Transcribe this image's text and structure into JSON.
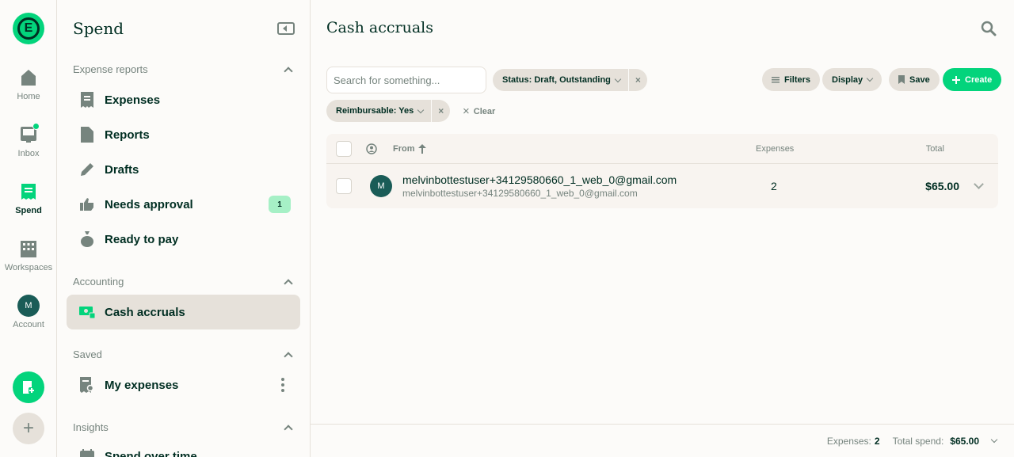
{
  "rail": {
    "items": [
      {
        "label": "Home",
        "icon": "home-icon"
      },
      {
        "label": "Inbox",
        "icon": "inbox-icon"
      },
      {
        "label": "Spend",
        "icon": "receipt-icon"
      },
      {
        "label": "Workspaces",
        "icon": "building-icon"
      },
      {
        "label": "Account",
        "icon": "avatar"
      }
    ],
    "account_initial": "M",
    "logo_letter": "E",
    "add_symbol": "+"
  },
  "sidebar": {
    "title": "Spend",
    "sections": [
      {
        "label": "Expense reports",
        "items": [
          {
            "label": "Expenses",
            "icon": "receipt-icon"
          },
          {
            "label": "Reports",
            "icon": "document-icon"
          },
          {
            "label": "Drafts",
            "icon": "pencil-icon"
          },
          {
            "label": "Needs approval",
            "icon": "thumbs-up-icon",
            "badge": "1"
          },
          {
            "label": "Ready to pay",
            "icon": "money-bag-icon"
          }
        ]
      },
      {
        "label": "Accounting",
        "items": [
          {
            "label": "Cash accruals",
            "icon": "cash-icon",
            "active": true
          }
        ]
      },
      {
        "label": "Saved",
        "items": [
          {
            "label": "My expenses",
            "icon": "receipt-search-icon"
          }
        ]
      },
      {
        "label": "Insights",
        "items": [
          {
            "label": "Spend over time",
            "icon": "calendar-icon"
          }
        ]
      }
    ]
  },
  "main": {
    "title": "Cash accruals",
    "search_placeholder": "Search for something...",
    "filters": {
      "status": "Status: Draft, Outstanding",
      "reimbursable": "Reimbursable: Yes",
      "clear": "Clear",
      "remove_symbol": "×"
    },
    "buttons": {
      "filters": "Filters",
      "display": "Display",
      "save": "Save",
      "create": "Create"
    },
    "table": {
      "columns": {
        "from": "From",
        "expenses": "Expenses",
        "total": "Total"
      },
      "rows": [
        {
          "initial": "M",
          "from_primary": "melvinbottestuser+34129580660_1_web_0@gmail.com",
          "from_secondary": "melvinbottestuser+34129580660_1_web_0@gmail.com",
          "expenses": "2",
          "total": "$65.00"
        }
      ]
    },
    "footer": {
      "expenses_label": "Expenses:",
      "expenses_value": "2",
      "total_label": "Total spend:",
      "total_value": "$65.00"
    }
  },
  "colors": {
    "brand_green": "#03d47c",
    "dark_green": "#002e22",
    "muted": "#76847e",
    "surface": "#e6e1da"
  }
}
